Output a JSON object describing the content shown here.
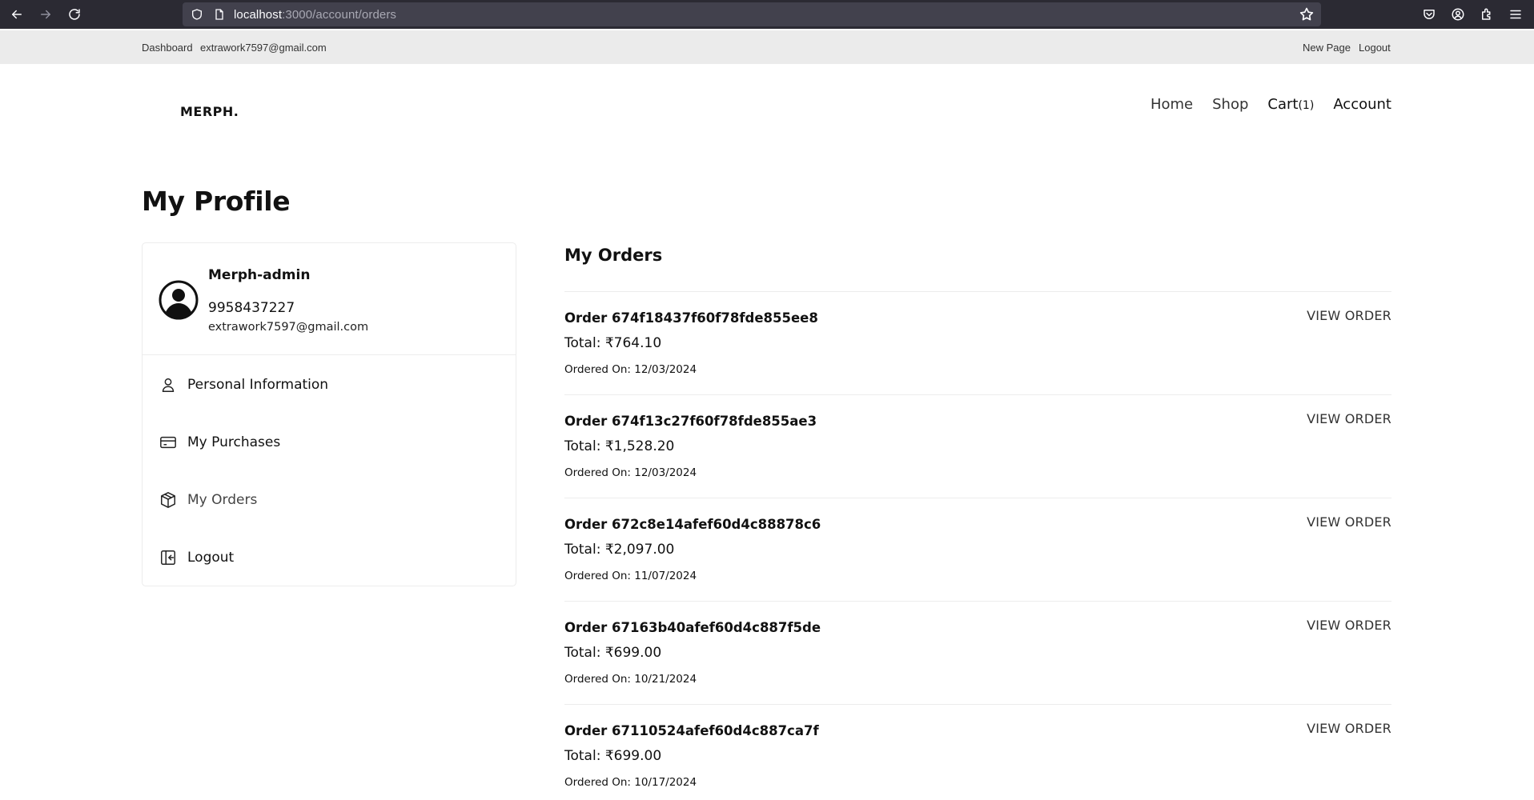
{
  "browser": {
    "url_host": "localhost",
    "url_path": ":3000/account/orders"
  },
  "top_strip": {
    "dashboard": "Dashboard",
    "email": "extrawork7597@gmail.com",
    "new_page": "New Page",
    "logout": "Logout"
  },
  "header": {
    "logo": "MERPH.",
    "nav": {
      "home": "Home",
      "shop": "Shop",
      "cart": "Cart",
      "cart_count": "(1)",
      "account": "Account"
    }
  },
  "page_title": "My Profile",
  "profile": {
    "name": "Merph-admin",
    "phone": "9958437227",
    "email": "extrawork7597@gmail.com",
    "menu": [
      {
        "label": "Personal Information",
        "icon": "user-icon"
      },
      {
        "label": "My Purchases",
        "icon": "credit-card-icon"
      },
      {
        "label": "My Orders",
        "icon": "box-icon"
      },
      {
        "label": "Logout",
        "icon": "logout-icon"
      }
    ]
  },
  "orders": {
    "title": "My Orders",
    "view_label": "VIEW ORDER",
    "items": [
      {
        "id": "Order 674f18437f60f78fde855ee8",
        "total": "Total: ₹764.10",
        "date": "Ordered On: 12/03/2024"
      },
      {
        "id": "Order 674f13c27f60f78fde855ae3",
        "total": "Total: ₹1,528.20",
        "date": "Ordered On: 12/03/2024"
      },
      {
        "id": "Order 672c8e14afef60d4c88878c6",
        "total": "Total: ₹2,097.00",
        "date": "Ordered On: 11/07/2024"
      },
      {
        "id": "Order 67163b40afef60d4c887f5de",
        "total": "Total: ₹699.00",
        "date": "Ordered On: 10/21/2024"
      },
      {
        "id": "Order 67110524afef60d4c887ca7f",
        "total": "Total: ₹699.00",
        "date": "Ordered On: 10/17/2024"
      }
    ]
  }
}
